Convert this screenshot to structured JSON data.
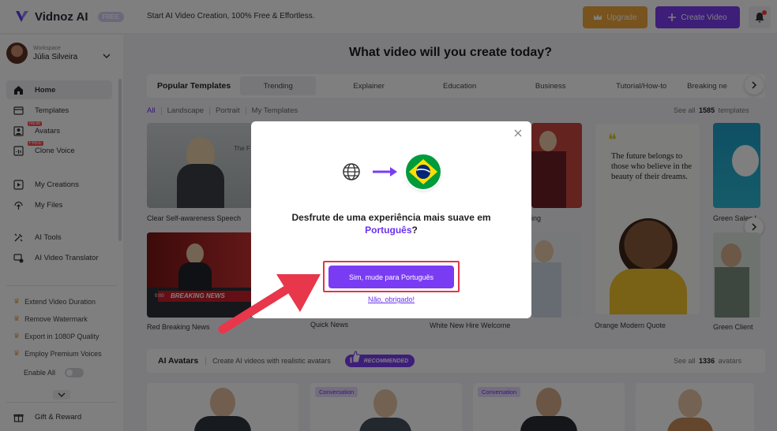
{
  "app": {
    "name": "Vidnoz AI",
    "plan_badge": "FREE"
  },
  "header": {
    "tagline": "Start AI Video Creation, 100% Free & Effortless.",
    "upgrade_label": "Upgrade",
    "create_label": "Create Video",
    "icons": [
      "crown-icon",
      "plus-icon",
      "bell-icon"
    ]
  },
  "workspace": {
    "label": "Workspace",
    "user": "Júlia Silveira"
  },
  "sidebar": {
    "items": [
      {
        "label": "Home",
        "icon": "home-icon",
        "active": true
      },
      {
        "label": "Templates",
        "icon": "templates-icon"
      },
      {
        "label": "Avatars",
        "icon": "avatar-icon",
        "tag": "NEW"
      },
      {
        "label": "Clone Voice",
        "icon": "voice-icon",
        "tag": "FREE"
      },
      {
        "label": "My Creations",
        "icon": "play-icon"
      },
      {
        "label": "My Files",
        "icon": "upload-icon"
      },
      {
        "label": "AI Tools",
        "icon": "tools-icon"
      },
      {
        "label": "AI Video Translator",
        "icon": "translate-icon"
      }
    ],
    "perks": [
      "Extend Video Duration",
      "Remove Watermark",
      "Export in 1080P Quality",
      "Employ Premium Voices"
    ],
    "enable_all": "Enable All",
    "gift": "Gift & Reward"
  },
  "main": {
    "headline": "What video will you create today?",
    "tabs_title": "Popular Templates",
    "tabs": [
      "Trending",
      "Explainer",
      "Education",
      "Business",
      "Tutorial/How-to",
      "Breaking ne"
    ],
    "filters": [
      "All",
      "Landscape",
      "Portrait",
      "My Templates"
    ],
    "see_all_templates": {
      "prefix": "See all",
      "count": "1585",
      "suffix": "templates"
    },
    "templates": [
      {
        "caption": "Clear Self-awareness Speech",
        "overlay_text": "The F Self-"
      },
      {
        "caption": "ing"
      },
      {
        "caption": "Green Sales I"
      },
      {
        "caption": "Red Breaking News",
        "overlay_text": "BREAKING NEWS",
        "time": "0:00"
      },
      {
        "caption": "Quick News"
      },
      {
        "caption": "White New Hire Welcome"
      },
      {
        "caption": "Orange Modern Quote",
        "quote": "The future belongs to those who believe in the beauty of their dreams."
      },
      {
        "caption": "Green Client"
      }
    ],
    "avatars_title": "AI Avatars",
    "avatars_sub": "Create AI videos with realistic avatars",
    "recommended": "RECOMMENDED",
    "see_all_avatars": {
      "prefix": "See all",
      "count": "1336",
      "suffix": "avatars"
    },
    "avatar_tag": "Conversation"
  },
  "modal": {
    "message_line1": "Desfrute de uma experiência mais suave em",
    "language": "Português",
    "question_mark": "?",
    "confirm_label": "Sim, mude para Português",
    "decline_label": "Não, obrigado!",
    "colors": {
      "accent": "#7a3cf3",
      "highlight_border": "#e23545",
      "arrow": "#e8364a"
    }
  }
}
